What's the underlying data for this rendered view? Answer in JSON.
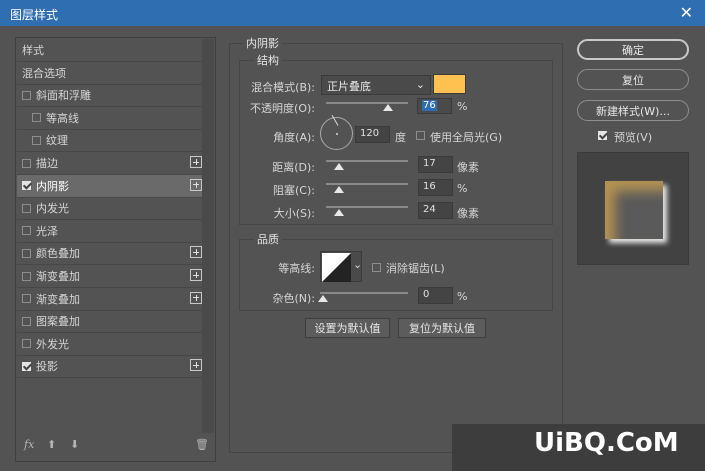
{
  "window": {
    "title": "图层样式",
    "close_glyph": "✕"
  },
  "left_panel": {
    "items": [
      {
        "label": "样式",
        "checkbox": false,
        "checked": false,
        "plus": false,
        "indent": 0,
        "selected": false
      },
      {
        "label": "混合选项",
        "checkbox": false,
        "checked": false,
        "plus": false,
        "indent": 0,
        "selected": false
      },
      {
        "label": "斜面和浮雕",
        "checkbox": true,
        "checked": false,
        "plus": false,
        "indent": 0,
        "selected": false
      },
      {
        "label": "等高线",
        "checkbox": true,
        "checked": false,
        "plus": false,
        "indent": 1,
        "selected": false
      },
      {
        "label": "纹理",
        "checkbox": true,
        "checked": false,
        "plus": false,
        "indent": 1,
        "selected": false
      },
      {
        "label": "描边",
        "checkbox": true,
        "checked": false,
        "plus": true,
        "indent": 0,
        "selected": false
      },
      {
        "label": "内阴影",
        "checkbox": true,
        "checked": true,
        "plus": true,
        "indent": 0,
        "selected": true
      },
      {
        "label": "内发光",
        "checkbox": true,
        "checked": false,
        "plus": false,
        "indent": 0,
        "selected": false
      },
      {
        "label": "光泽",
        "checkbox": true,
        "checked": false,
        "plus": false,
        "indent": 0,
        "selected": false
      },
      {
        "label": "颜色叠加",
        "checkbox": true,
        "checked": false,
        "plus": true,
        "indent": 0,
        "selected": false
      },
      {
        "label": "渐变叠加",
        "checkbox": true,
        "checked": false,
        "plus": true,
        "indent": 0,
        "selected": false
      },
      {
        "label": "渐变叠加",
        "checkbox": true,
        "checked": false,
        "plus": true,
        "indent": 0,
        "selected": false
      },
      {
        "label": "图案叠加",
        "checkbox": true,
        "checked": false,
        "plus": false,
        "indent": 0,
        "selected": false
      },
      {
        "label": "外发光",
        "checkbox": true,
        "checked": false,
        "plus": false,
        "indent": 0,
        "selected": false
      },
      {
        "label": "投影",
        "checkbox": true,
        "checked": true,
        "plus": true,
        "indent": 0,
        "selected": false
      }
    ],
    "footer": {
      "fx": "fx",
      "up_glyph": "⬆",
      "down_glyph": "⬇",
      "trash_glyph": "🗑"
    }
  },
  "inner_shadow": {
    "section_title": "内阴影",
    "structure": {
      "title": "结构",
      "blend_mode_label": "混合模式(B):",
      "blend_mode_value": "正片叠底",
      "color": "#ffc14f",
      "opacity_label": "不透明度(O):",
      "opacity_value": "76",
      "opacity_unit": "%",
      "angle_label": "角度(A):",
      "angle_value": "120",
      "angle_unit": "度",
      "global_light_label": "使用全局光(G)",
      "distance_label": "距离(D):",
      "distance_value": "17",
      "distance_unit": "像素",
      "choke_label": "阻塞(C):",
      "choke_value": "16",
      "choke_unit": "%",
      "size_label": "大小(S):",
      "size_value": "24",
      "size_unit": "像素"
    },
    "quality": {
      "title": "品质",
      "contour_label": "等高线:",
      "antialias_label": "消除锯齿(L)",
      "noise_label": "杂色(N):",
      "noise_value": "0",
      "noise_unit": "%"
    },
    "set_default_label": "设置为默认值",
    "reset_default_label": "复位为默认值"
  },
  "right_panel": {
    "ok_label": "确定",
    "reset_label": "复位",
    "new_style_label": "新建样式(W)...",
    "preview_label": "预览(V)",
    "preview_checked": true
  },
  "watermark": "UiBQ.CoM"
}
